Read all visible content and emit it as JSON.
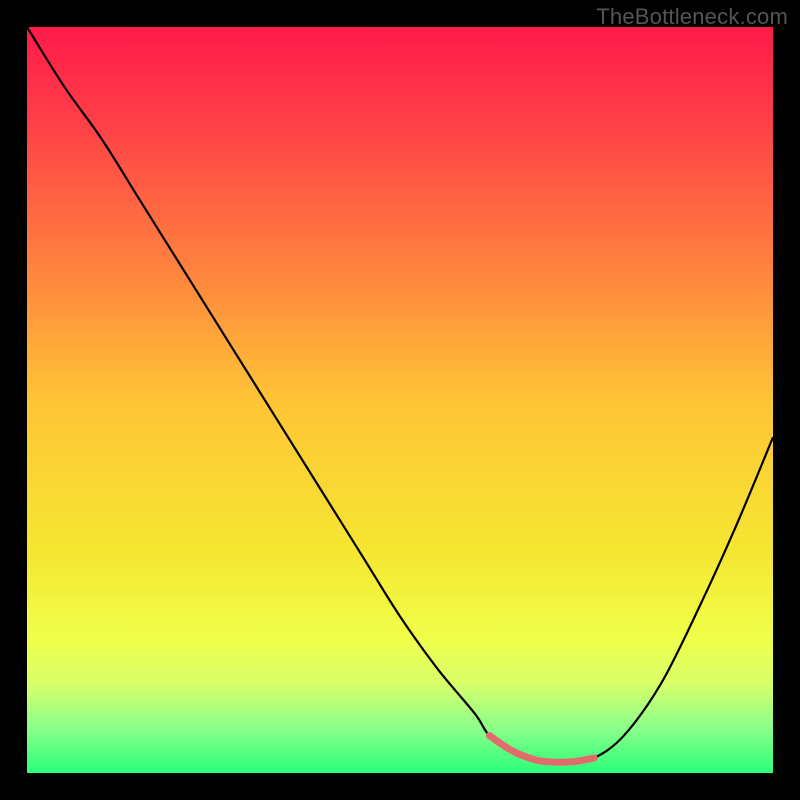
{
  "watermark": "TheBottleneck.com",
  "chart_data": {
    "type": "line",
    "title": "",
    "xlabel": "",
    "ylabel": "",
    "xlim": [
      0,
      100
    ],
    "ylim": [
      0,
      100
    ],
    "grid": false,
    "background_gradient": {
      "type": "vertical",
      "stops": [
        {
          "offset": 0.0,
          "color": "#ff1a4a"
        },
        {
          "offset": 0.12,
          "color": "#ff3d48"
        },
        {
          "offset": 0.3,
          "color": "#ff7a3f"
        },
        {
          "offset": 0.5,
          "color": "#ffc436"
        },
        {
          "offset": 0.7,
          "color": "#f5e631"
        },
        {
          "offset": 0.82,
          "color": "#f0ff4a"
        },
        {
          "offset": 0.88,
          "color": "#d8ff6a"
        },
        {
          "offset": 0.94,
          "color": "#8aff8a"
        },
        {
          "offset": 1.0,
          "color": "#2bff7a"
        }
      ]
    },
    "series": [
      {
        "name": "curve",
        "color": "#000000",
        "stroke_width": 2.2,
        "x": [
          0,
          5,
          10,
          15,
          20,
          25,
          30,
          35,
          40,
          45,
          50,
          55,
          60,
          62,
          65,
          68,
          70,
          73,
          76,
          80,
          85,
          90,
          95,
          100
        ],
        "values": [
          100,
          92,
          85,
          77,
          69,
          61,
          53,
          45,
          37,
          29,
          21,
          14,
          8,
          5,
          3,
          1.8,
          1.5,
          1.5,
          2,
          5,
          12,
          22,
          33,
          45
        ]
      },
      {
        "name": "sweet-spot",
        "color": "#e46b6b",
        "stroke_width": 7,
        "x": [
          62,
          65,
          68,
          70,
          73,
          76
        ],
        "values": [
          5,
          3,
          1.8,
          1.5,
          1.5,
          2
        ]
      }
    ],
    "endpoints": [
      {
        "x": 62,
        "y": 5,
        "r": 3.6,
        "color": "#e46b6b"
      },
      {
        "x": 76,
        "y": 2,
        "r": 3.6,
        "color": "#e46b6b"
      }
    ]
  }
}
